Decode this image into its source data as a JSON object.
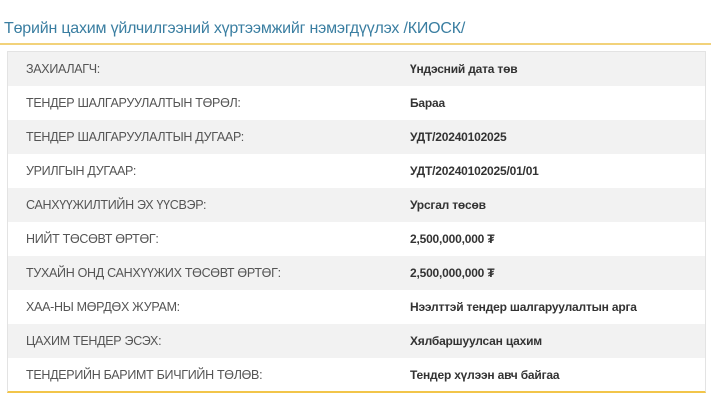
{
  "title": "Төрийн цахим үйлчилгээний хүртээмжийг нэмэгдүүлэх /КИОСК/",
  "colors": {
    "title": "#3a7ea1",
    "accent": "#f2c54a",
    "row_alt": "#f2f2f2"
  },
  "rows": [
    {
      "label": "ЗАХИАЛАГЧ:",
      "value": "Үндэсний дата төв"
    },
    {
      "label": "ТЕНДЕР ШАЛГАРУУЛАЛТЫН ТӨРӨЛ:",
      "value": "Бараа"
    },
    {
      "label": "ТЕНДЕР ШАЛГАРУУЛАЛТЫН ДУГААР:",
      "value": "УДТ/20240102025"
    },
    {
      "label": "УРИЛГЫН ДУГААР:",
      "value": "УДТ/20240102025/01/01"
    },
    {
      "label": "САНХҮҮЖИЛТИЙН ЭХ ҮҮСВЭР:",
      "value": "Урсгал төсөв"
    },
    {
      "label": "НИЙТ ТӨСӨВТ ӨРТӨГ:",
      "value": "2,500,000,000 ₮"
    },
    {
      "label": "ТУХАЙН ОНД САНХҮҮЖИХ ТӨСӨВТ ӨРТӨГ:",
      "value": "2,500,000,000 ₮"
    },
    {
      "label": "ХАА-НЫ МӨРДӨХ ЖУРАМ:",
      "value": "Нээлттэй тендер шалгаруулалтын арга"
    },
    {
      "label": "ЦАХИМ ТЕНДЕР ЭСЭХ:",
      "value": "Хялбаршуулсан цахим"
    },
    {
      "label": "ТЕНДЕРИЙН БАРИМТ БИЧГИЙН ТӨЛӨВ:",
      "value": "Тендер хүлээн авч байгаа"
    }
  ]
}
